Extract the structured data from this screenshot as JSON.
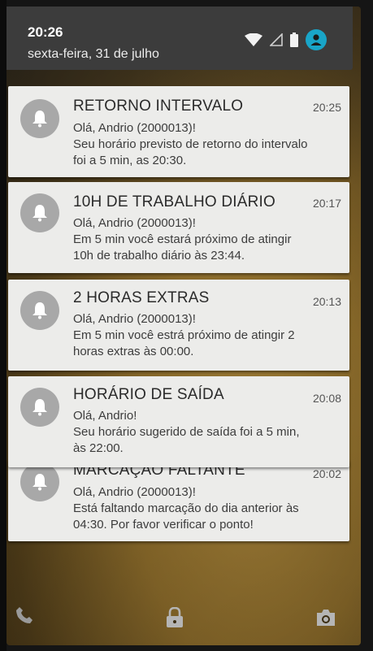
{
  "status_bar": {
    "time": "20:26",
    "date": "sexta-feira, 31 de julho",
    "icons": [
      "wifi-icon",
      "signal-icon",
      "battery-icon",
      "account-icon"
    ],
    "accent_color": "#19a5c8"
  },
  "notifications": [
    {
      "title": "RETORNO INTERVALO",
      "time": "20:25",
      "lines": [
        "Olá, Andrio (2000013)!",
        "Seu horário previsto de retorno do intervalo",
        "foi a 5 min, as 20:30."
      ]
    },
    {
      "title": "10H DE TRABALHO DIÁRIO",
      "time": "20:17",
      "lines": [
        "Olá, Andrio (2000013)!",
        "Em 5 min você estará próximo de atingir",
        "10h de trabalho diário às 23:44."
      ]
    },
    {
      "title": "2 HORAS EXTRAS",
      "time": "20:13",
      "lines": [
        "Olá, Andrio (2000013)!",
        "Em 5 min você estrá próximo de atingir 2",
        "horas extras às 00:00."
      ]
    },
    {
      "title": "HORÁRIO DE SAÍDA",
      "time": "20:08",
      "lines": [
        "Olá, Andrio!",
        "Seu horário sugerido de saída foi a 5 min,",
        "às 22:00."
      ]
    },
    {
      "title": "MARCAÇÃO FALTANTE",
      "time": "20:02",
      "lines": [
        "Olá, Andrio (2000013)!",
        "Está faltando marcação do dia anterior às",
        "04:30. Por favor verificar o ponto!"
      ]
    }
  ],
  "bottom_bar": {
    "icons": [
      "phone-icon",
      "lock-icon",
      "camera-icon"
    ]
  }
}
